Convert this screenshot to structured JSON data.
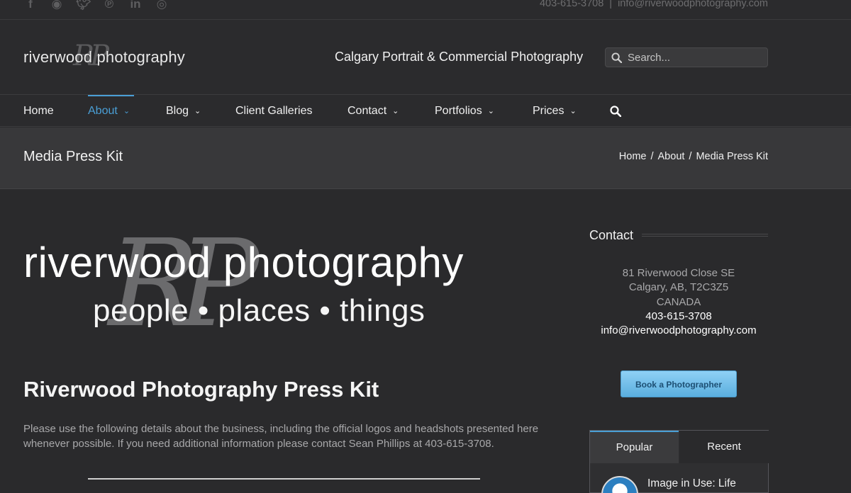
{
  "topbar": {
    "social_icons": [
      "facebook-icon",
      "rss-icon",
      "twitter-icon",
      "pinterest-icon",
      "linkedin-icon",
      "instagram-icon"
    ],
    "phone": "403-615-3708",
    "separator": "|",
    "email": "info@riverwoodphotography.com"
  },
  "header": {
    "logo_text": "riverwood photography",
    "logo_monogram": "RP",
    "tagline": "Calgary Portrait & Commercial Photography",
    "search_placeholder": "Search..."
  },
  "nav": {
    "items": [
      {
        "label": "Home",
        "dropdown": false
      },
      {
        "label": "About",
        "dropdown": true,
        "active": true
      },
      {
        "label": "Blog",
        "dropdown": true
      },
      {
        "label": "Client Galleries",
        "dropdown": false
      },
      {
        "label": "Contact",
        "dropdown": true
      },
      {
        "label": "Portfolios",
        "dropdown": true
      },
      {
        "label": "Prices",
        "dropdown": true
      }
    ],
    "search_icon": "search-icon"
  },
  "titlebar": {
    "title": "Media Press Kit",
    "breadcrumb": [
      "Home",
      "About",
      "Media Press Kit"
    ],
    "breadcrumb_sep": "/"
  },
  "hero": {
    "brand": "riverwood photography",
    "subline": "people • places • things",
    "monogram": "RP"
  },
  "main": {
    "heading": "Riverwood Photography Press Kit",
    "intro": "Please use the following details about the business, including the official logos and headshots presented here whenever possible. If you need additional information please contact Sean Phillips at 403-615-3708."
  },
  "sidebar": {
    "contact_title": "Contact",
    "address_line1": "81 Riverwood Close SE",
    "address_line2": "Calgary, AB, T2C3Z5",
    "address_line3": "CANADA",
    "phone": "403-615-3708",
    "email": "info@riverwoodphotography.com",
    "book_button": "Book a Photographer",
    "tabs": [
      "Popular",
      "Recent"
    ],
    "post_title": "Image in Use: Life"
  },
  "colors": {
    "accent": "#4a9fd6",
    "background": "#2a2a2c",
    "button": "#6cbce9"
  }
}
